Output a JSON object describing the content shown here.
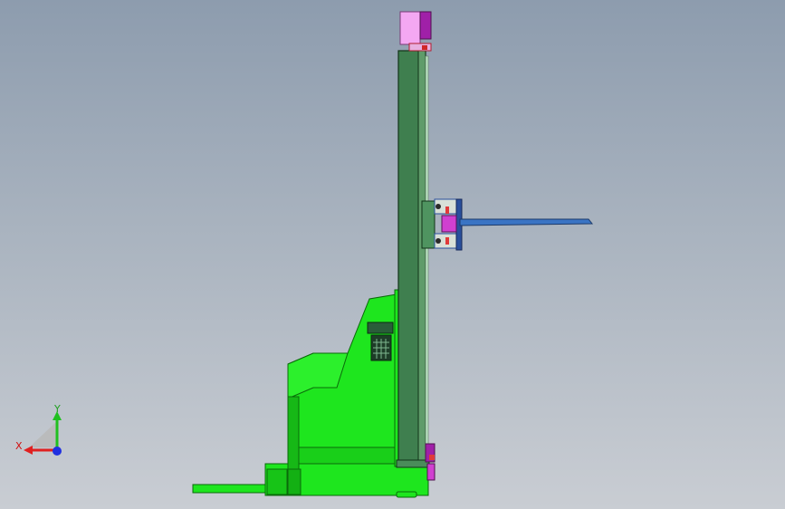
{
  "viewport": {
    "background_top": "#8d9cae",
    "background_bottom": "#c9cdd3"
  },
  "model": {
    "colors": {
      "body_green": "#1ee61e",
      "body_edge": "#0a6a0a",
      "mast_green": "#3f7f4f",
      "mast_edge": "#123318",
      "top_pink": "#f4a8f2",
      "top_purple": "#a020a8",
      "fork_blue": "#3a74c4",
      "carriage_blue": "#2a4f9c",
      "accent_red": "#e03a3a",
      "accent_magenta": "#d040d0"
    }
  },
  "triad": {
    "x_label": "X",
    "y_label": "Y",
    "x_color": "#e02020",
    "y_color": "#20c020",
    "z_color": "#2030e0"
  }
}
